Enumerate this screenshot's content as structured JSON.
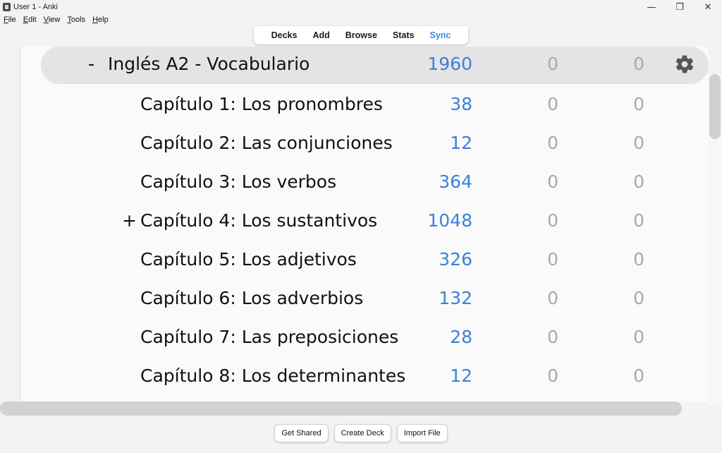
{
  "window": {
    "title": "User 1 - Anki",
    "minimize_glyph": "—",
    "maximize_glyph": "❐",
    "close_glyph": "✕"
  },
  "menu": [
    {
      "label": "File",
      "accel": "F",
      "rest": "ile"
    },
    {
      "label": "Edit",
      "accel": "E",
      "rest": "dit"
    },
    {
      "label": "View",
      "accel": "V",
      "rest": "iew"
    },
    {
      "label": "Tools",
      "accel": "T",
      "rest": "ools"
    },
    {
      "label": "Help",
      "accel": "H",
      "rest": "elp"
    }
  ],
  "toolbar": {
    "decks": "Decks",
    "add": "Add",
    "browse": "Browse",
    "stats": "Stats",
    "sync": "Sync"
  },
  "decks": {
    "parent": {
      "toggle": "-",
      "name": "Inglés A2 - Vocabulario",
      "new": "1960",
      "learn": "0",
      "due": "0"
    },
    "children": [
      {
        "toggle": "",
        "name": "Capítulo 1: Los pronombres",
        "new": "38",
        "learn": "0",
        "due": "0"
      },
      {
        "toggle": "",
        "name": "Capítulo 2: Las conjunciones",
        "new": "12",
        "learn": "0",
        "due": "0"
      },
      {
        "toggle": "",
        "name": "Capítulo 3: Los verbos",
        "new": "364",
        "learn": "0",
        "due": "0"
      },
      {
        "toggle": "+",
        "name": "Capítulo 4: Los sustantivos",
        "new": "1048",
        "learn": "0",
        "due": "0"
      },
      {
        "toggle": "",
        "name": "Capítulo 5: Los adjetivos",
        "new": "326",
        "learn": "0",
        "due": "0"
      },
      {
        "toggle": "",
        "name": "Capítulo 6: Los adverbios",
        "new": "132",
        "learn": "0",
        "due": "0"
      },
      {
        "toggle": "",
        "name": "Capítulo 7: Las preposiciones",
        "new": "28",
        "learn": "0",
        "due": "0"
      },
      {
        "toggle": "",
        "name": "Capítulo 8: Los determinantes",
        "new": "12",
        "learn": "0",
        "due": "0"
      }
    ]
  },
  "bottom": {
    "get_shared": "Get Shared",
    "create_deck": "Create Deck",
    "import_file": "Import File"
  },
  "colors": {
    "new_count": "#3b82d6",
    "zero_count": "#a9a9a9",
    "sync_link": "#3a8be6",
    "current_row_bg": "#e4e4e4"
  }
}
